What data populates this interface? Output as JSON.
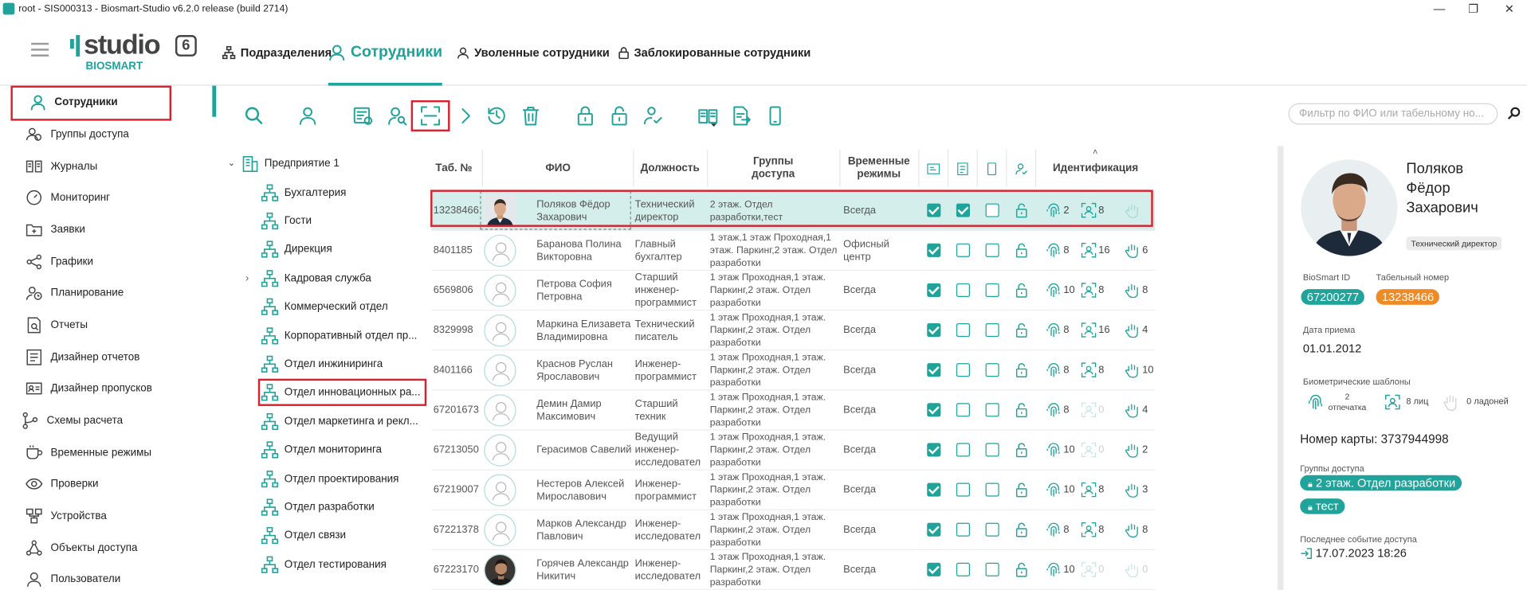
{
  "window": {
    "title": "root - SIS000313 - Biosmart-Studio v6.2.0 release (build 2714)",
    "minimize": "—",
    "restore": "❐",
    "close": "✕"
  },
  "logo": {
    "text": "studio",
    "badge": "6",
    "brand": "BIOSMART"
  },
  "nav": {
    "tabs": [
      {
        "label": "Подразделения",
        "icon": "org-icon"
      },
      {
        "label": "Сотрудники",
        "icon": "person-icon",
        "active": true
      },
      {
        "label": "Уволенные сотрудники",
        "icon": "person-icon"
      },
      {
        "label": "Заблокированные сотрудники",
        "icon": "lock-icon"
      }
    ]
  },
  "sidebar": {
    "items": [
      {
        "label": "Сотрудники",
        "icon": "person-icon",
        "active": true
      },
      {
        "label": "Группы доступа",
        "icon": "group-icon"
      },
      {
        "label": "Журналы",
        "icon": "journal-icon"
      },
      {
        "label": "Мониторинг",
        "icon": "gauge-icon"
      },
      {
        "label": "Заявки",
        "icon": "folder-icon"
      },
      {
        "label": "Графики",
        "icon": "share-icon"
      },
      {
        "label": "Планирование",
        "icon": "plan-icon"
      },
      {
        "label": "Отчеты",
        "icon": "report-icon"
      },
      {
        "label": "Дизайнер отчетов",
        "icon": "report-designer-icon"
      },
      {
        "label": "Дизайнер пропусков",
        "icon": "card-designer-icon"
      },
      {
        "label": "Схемы расчета",
        "icon": "scheme-icon"
      },
      {
        "label": "Временные режимы",
        "icon": "cup-icon"
      },
      {
        "label": "Проверки",
        "icon": "eye-icon"
      },
      {
        "label": "Устройства",
        "icon": "device-icon"
      },
      {
        "label": "Объекты доступа",
        "icon": "objects-icon"
      },
      {
        "label": "Пользователи",
        "icon": "person-icon"
      }
    ]
  },
  "toolbar": {
    "search_placeholder": "Фильтр по ФИО или табельному но..."
  },
  "tree": {
    "root": "Предприятие 1",
    "items": [
      "Бухгалтерия",
      "Гости",
      "Дирекция",
      "Кадровая служба",
      "Коммерческий отдел",
      "Корпоративный отдел пр...",
      "Отдел инжиниринга",
      "Отдел инновационных ра...",
      "Отдел маркетинга и рекл...",
      "Отдел мониторинга",
      "Отдел проектирования",
      "Отдел разработки",
      "Отдел связи",
      "Отдел тестирования"
    ]
  },
  "table": {
    "headers": {
      "tab": "Таб. №",
      "fio": "ФИО",
      "position": "Должность",
      "groups": "Группы доступа",
      "modes": "Временные режимы",
      "ident": "Идентификация"
    },
    "rows": [
      {
        "tab": "13238466",
        "fio": "Поляков Фёдор Захарович",
        "position": "Технический директор",
        "groups": "2 этаж. Отдел разработки,тест",
        "mode": "Всегда",
        "c1": true,
        "c2": true,
        "c3": false,
        "f": "2",
        "face": "8",
        "palm": "",
        "photo": true
      },
      {
        "tab": "8401185",
        "fio": "Баранова Полина Викторовна",
        "position": "Главный бухгалтер",
        "groups": "1 этаж,1 этаж Проходная,1 этаж. Паркинг,2 этаж. Отдел разработки",
        "mode": "Офисный центр",
        "c1": true,
        "c2": false,
        "c3": false,
        "f": "8",
        "face": "16",
        "palm": "6"
      },
      {
        "tab": "6569806",
        "fio": "Петрова София Петровна",
        "position": "Старший инженер-программист",
        "groups": "1 этаж Проходная,1 этаж. Паркинг,2 этаж. Отдел разработки",
        "mode": "Всегда",
        "c1": true,
        "c2": false,
        "c3": false,
        "f": "10",
        "face": "8",
        "palm": "8"
      },
      {
        "tab": "8329998",
        "fio": "Маркина Елизавета Владимировна",
        "position": "Технический писатель",
        "groups": "1 этаж Проходная,1 этаж. Паркинг,2 этаж. Отдел разработки",
        "mode": "Всегда",
        "c1": true,
        "c2": false,
        "c3": false,
        "f": "8",
        "face": "16",
        "palm": "4"
      },
      {
        "tab": "8401166",
        "fio": "Краснов Руслан Ярославович",
        "position": "Инженер-программист",
        "groups": "1 этаж Проходная,1 этаж. Паркинг,2 этаж. Отдел разработки",
        "mode": "Всегда",
        "c1": true,
        "c2": false,
        "c3": false,
        "f": "8",
        "face": "8",
        "palm": "10"
      },
      {
        "tab": "67201673",
        "fio": "Демин Дамир Максимович",
        "position": "Старший техник",
        "groups": "1 этаж Проходная,1 этаж. Паркинг,2 этаж. Отдел разработки",
        "mode": "Всегда",
        "c1": true,
        "c2": false,
        "c3": false,
        "f": "8",
        "face": "0",
        "palm": "4",
        "faceDim": true
      },
      {
        "tab": "67213050",
        "fio": "Герасимов Савелий",
        "position": "Ведущий инженер-исследовател",
        "groups": "1 этаж Проходная,1 этаж. Паркинг,2 этаж. Отдел разработки",
        "mode": "Всегда",
        "c1": true,
        "c2": false,
        "c3": false,
        "f": "10",
        "face": "0",
        "palm": "2",
        "faceDim": true
      },
      {
        "tab": "67219007",
        "fio": "Нестеров Алексей Мирославович",
        "position": "Инженер-программист",
        "groups": "1 этаж Проходная,1 этаж. Паркинг,2 этаж. Отдел разработки",
        "mode": "Всегда",
        "c1": true,
        "c2": false,
        "c3": false,
        "f": "10",
        "face": "8",
        "palm": "3"
      },
      {
        "tab": "67221378",
        "fio": "Марков Александр Павлович",
        "position": "Инженер-исследовател",
        "groups": "1 этаж Проходная,1 этаж. Паркинг,2 этаж. Отдел разработки",
        "mode": "Всегда",
        "c1": true,
        "c2": false,
        "c3": false,
        "f": "8",
        "face": "8",
        "palm": "8"
      },
      {
        "tab": "67223170",
        "fio": "Горячев Александр Никитич",
        "position": "Инженер-исследовател",
        "groups": "1 этаж Проходная,1 этаж. Паркинг,2 этаж. Отдел разработки",
        "mode": "Всегда",
        "c1": true,
        "c2": false,
        "c3": false,
        "f": "10",
        "face": "0",
        "palm": "0",
        "faceDim": true,
        "palmDim": true,
        "photo": true
      }
    ]
  },
  "panel": {
    "name_l1": "Поляков",
    "name_l2": "Фёдор",
    "name_l3": "Захарович",
    "position": "Технический директор",
    "biosmart_id_label": "BioSmart ID",
    "biosmart_id": "67200277",
    "tab_label": "Табельный номер",
    "tab": "13238466",
    "hire_label": "Дата приема",
    "hire": "01.01.2012",
    "bio_label": "Биометрические шаблоны",
    "fp_count": "2",
    "fp_word": "отпечатка",
    "face_text": "8 лиц",
    "palm_text": "0 ладоней",
    "card": "Номер карты: 3737944998",
    "groups_label": "Группы доступа",
    "groups": [
      "2 этаж. Отдел разработки",
      "тест"
    ],
    "last_event_label": "Последнее событие доступа",
    "last_event": "17.07.2023 18:26"
  },
  "colors": {
    "accent": "#1fa39a",
    "orange": "#f08a24",
    "highlight": "#d6232f"
  }
}
